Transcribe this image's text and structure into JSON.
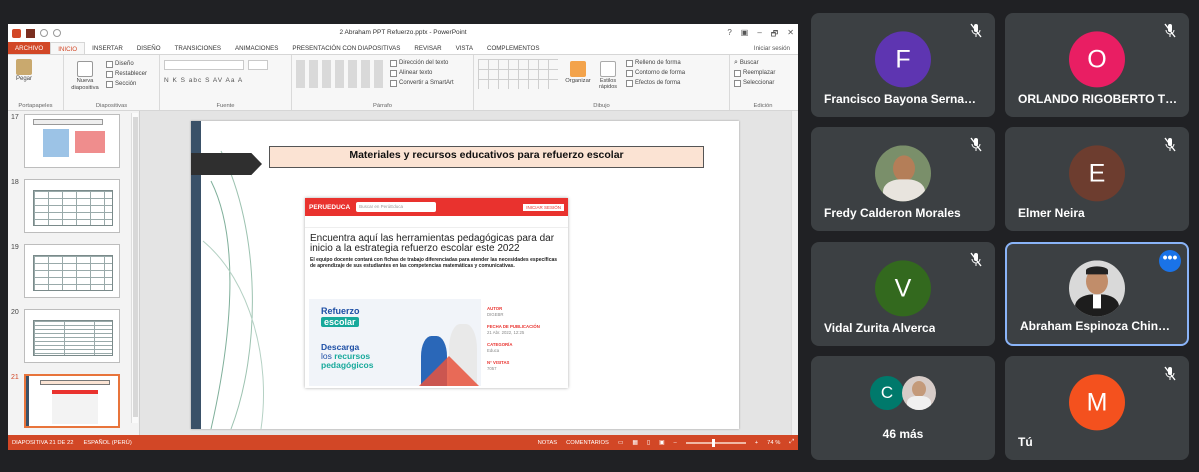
{
  "window": {
    "title": "2 Abraham PPT Refuerzo.pptx - PowerPoint",
    "controls": [
      "?",
      "▣",
      "–",
      "🗗",
      "✕"
    ]
  },
  "ribbon": {
    "tabs": [
      "ARCHIVO",
      "INICIO",
      "INSERTAR",
      "DISEÑO",
      "TRANSICIONES",
      "ANIMACIONES",
      "PRESENTACIÓN CON DIAPOSITIVAS",
      "REVISAR",
      "VISTA",
      "COMPLEMENTOS"
    ],
    "sign_in": "Iniciar sesión",
    "groups": {
      "clipboard": {
        "label": "Portapapeles",
        "paste": "Pegar"
      },
      "slides": {
        "label": "Diapositivas",
        "new_slide": "Nueva diapositiva",
        "layout": "Diseño",
        "reset": "Restablecer",
        "section": "Sección"
      },
      "font": {
        "label": "Fuente",
        "buttons": "N K S abc S AV Aa A"
      },
      "paragraph": {
        "label": "Párrafo",
        "text_direction": "Dirección del texto",
        "align_text": "Alinear texto",
        "smartart": "Convertir a SmartArt"
      },
      "drawing": {
        "label": "Dibujo",
        "arrange": "Organizar",
        "styles": "Estilos rápidos",
        "fill": "Relleno de forma",
        "outline": "Contorno de forma",
        "effects": "Efectos de forma"
      },
      "editing": {
        "label": "Edición",
        "find": "Buscar",
        "replace": "Reemplazar",
        "select": "Seleccionar"
      }
    }
  },
  "thumbnails": [
    {
      "num": "17"
    },
    {
      "num": "18"
    },
    {
      "num": "19"
    },
    {
      "num": "20"
    },
    {
      "num": "21",
      "selected": true
    }
  ],
  "slide": {
    "title": "Materiales y recursos educativos para refuerzo escolar",
    "web": {
      "logo": "PERUEDUCA",
      "search_placeholder": "Buscar en PerúEduca",
      "button": "INICIAR SESIÓN",
      "heading": "Encuentra aquí las herramientas pedagógicas para dar inicio a la estrategia refuerzo escolar este 2022",
      "description": "El equipo docente contará con fichas de trabajo diferenciadas para atender las necesidades específicas de aprendizaje de sus estudiantes en las competencias matemáticas y comunicativas.",
      "banner_logo_1": "Refuerzo",
      "banner_logo_2": "escolar",
      "banner_line_1": "Descarga",
      "banner_line_2a": "los",
      "banner_line_2b": "recursos",
      "banner_line_3": "pedagógicos",
      "meta": [
        {
          "label": "AUTOR",
          "value": "DIGEBR"
        },
        {
          "label": "FECHA DE PUBLICACIÓN",
          "value": "21 Abr. 2022, 12:25"
        },
        {
          "label": "CATEGORÍA",
          "value": "Educa"
        },
        {
          "label": "N° VISITAS",
          "value": "7057"
        }
      ]
    }
  },
  "statusbar": {
    "slide_info": "DIAPOSITIVA 21 DE 22",
    "language": "ESPAÑOL (PERÚ)",
    "notes": "NOTAS",
    "comments": "COMENTARIOS",
    "zoom": "74 %",
    "zoom_level_percent": 74
  },
  "meet": {
    "tiles": [
      {
        "name": "Francisco Bayona Serna…",
        "initial": "F",
        "color": "#5e35b1",
        "muted": true
      },
      {
        "name": "ORLANDO RIGOBERTO T…",
        "initial": "O",
        "color": "#e91e63",
        "muted": true
      },
      {
        "name": "Fredy Calderon Morales",
        "initial": "",
        "photo": true,
        "muted": true
      },
      {
        "name": "Elmer Neira",
        "initial": "E",
        "color": "#6d3d2f",
        "muted": true
      },
      {
        "name": "Vidal Zurita Alverca",
        "initial": "V",
        "color": "#33691e",
        "muted": true
      },
      {
        "name": "Abraham Espinoza Chin…",
        "initial": "",
        "photo": true,
        "active": true,
        "more": "•••"
      },
      {
        "name": "46 más",
        "initial": "C",
        "color": "#00796b"
      },
      {
        "name": "Tú",
        "initial": "M",
        "color": "#f4511e",
        "muted": true
      }
    ]
  }
}
